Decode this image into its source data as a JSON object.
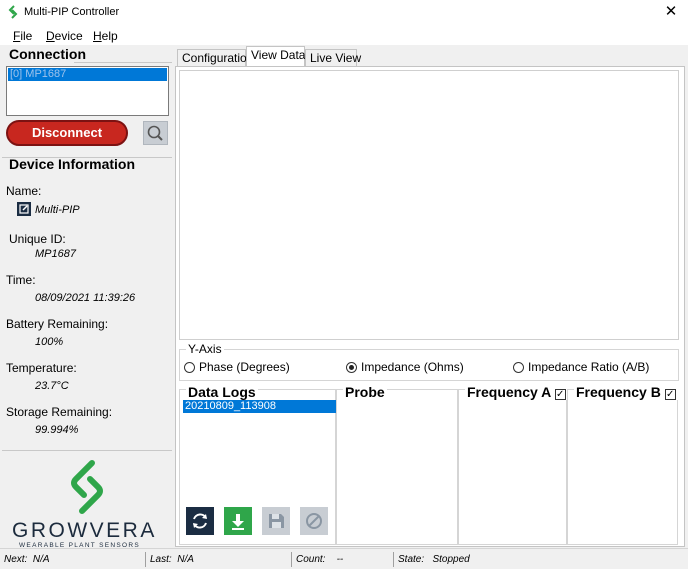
{
  "window": {
    "title": "Multi-PIP Controller",
    "close_glyph": "✕"
  },
  "menu": [
    {
      "key": "F",
      "rest": "ile"
    },
    {
      "key": "D",
      "rest": "evice"
    },
    {
      "key": "H",
      "rest": "elp"
    }
  ],
  "connection": {
    "title": "Connection",
    "selected_device": "[0] MP1687",
    "disconnect_label": "Disconnect"
  },
  "device_info": {
    "title": "Device Information",
    "name_label": "Name:",
    "name_value": "Multi-PIP",
    "uid_label": "Unique ID:",
    "uid_value": "MP1687",
    "time_label": "Time:",
    "time_value": "08/09/2021 11:39:26",
    "battery_label": "Battery Remaining:",
    "battery_value": "100%",
    "temp_label": "Temperature:",
    "temp_value": "23.7°C",
    "storage_label": "Storage Remaining:",
    "storage_value": "99.994%"
  },
  "brand": {
    "name": "GROWVERA",
    "tagline": "WEARABLE PLANT SENSORS",
    "color": "#2fa64a"
  },
  "tabs": [
    "Configuration",
    "View Data",
    "Live View"
  ],
  "active_tab": "View Data",
  "y_axis": {
    "title": "Y-Axis",
    "options": [
      "Phase (Degrees)",
      "Impedance (Ohms)",
      "Impedance Ratio (A/B)"
    ],
    "selected": "Impedance (Ohms)"
  },
  "data_logs": {
    "title": "Data Logs",
    "entries": [
      "20210809_113908"
    ]
  },
  "probe": {
    "title": "Probe"
  },
  "freq_a": {
    "title": "Frequency A",
    "checked": true
  },
  "freq_b": {
    "title": "Frequency B",
    "checked": true
  },
  "check_glyph": "✓",
  "status": {
    "next_label": "Next:",
    "next_value": "N/A",
    "last_label": "Last:",
    "last_value": "N/A",
    "count_label": "Count:",
    "count_value": "--",
    "state_label": "State:",
    "state_value": "Stopped"
  },
  "colors": {
    "accent": "#0078d7",
    "disconnect": "#c8271f",
    "navy": "#1b2d43",
    "download": "#2fa64a"
  }
}
